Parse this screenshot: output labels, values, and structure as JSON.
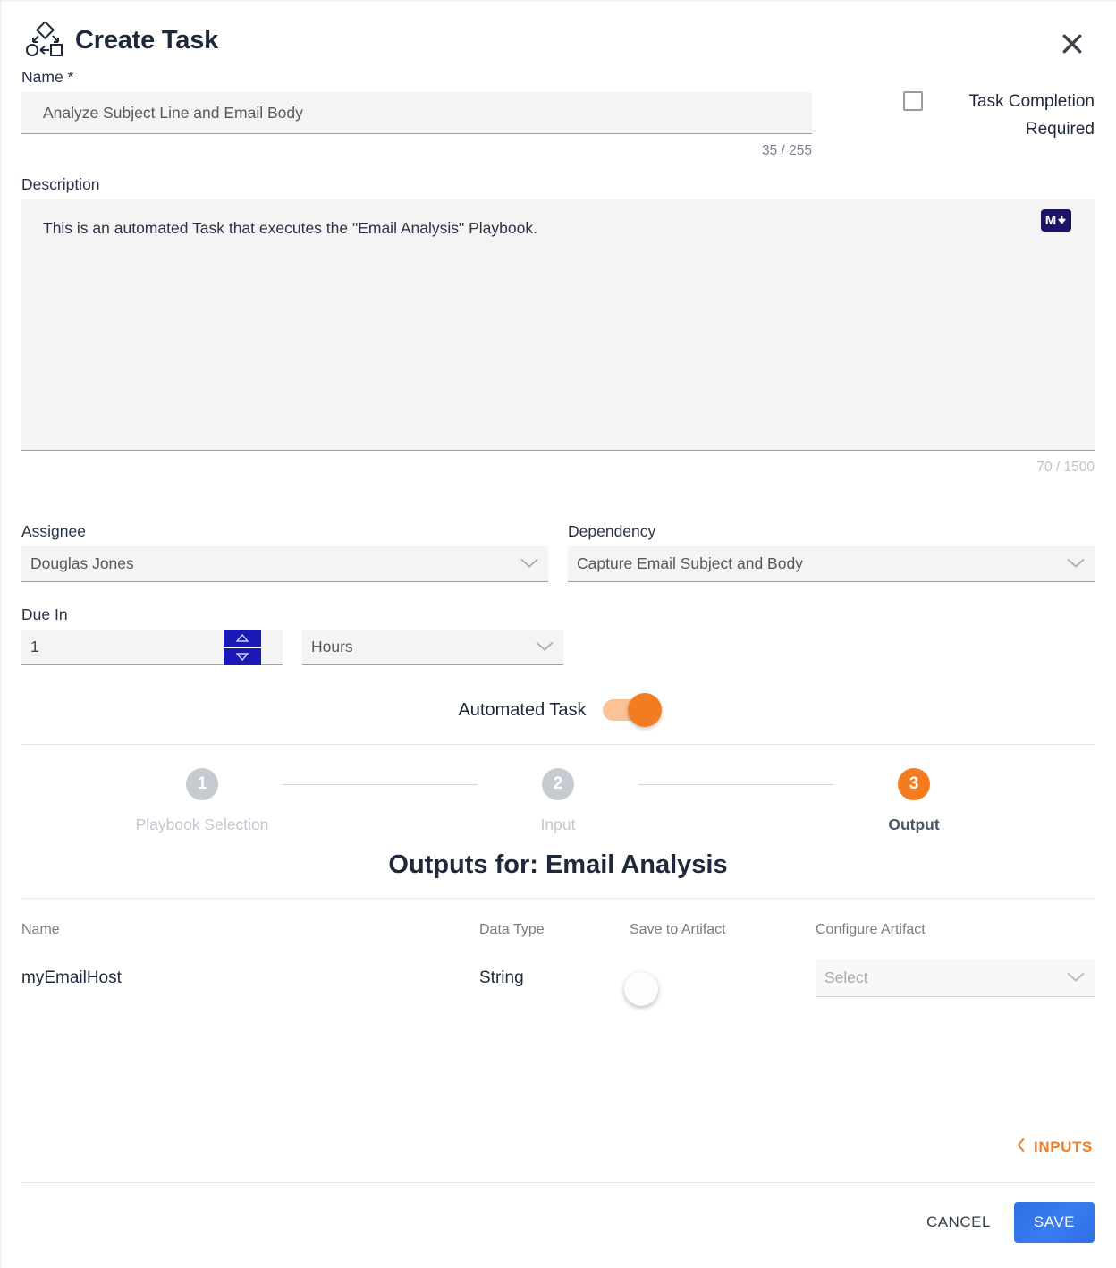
{
  "header": {
    "title": "Create Task",
    "icon": "workflow-icon",
    "close_icon": "close-icon"
  },
  "name_field": {
    "label": "Name *",
    "value": "Analyze Subject Line and Email Body",
    "placeholder": "Name",
    "counter": "35 / 255"
  },
  "task_completion": {
    "label": "Task Completion Required",
    "checked": false
  },
  "description_field": {
    "label": "Description",
    "value": "This is an automated Task that executes the \"Email Analysis\" Playbook.",
    "counter": "70 / 1500",
    "markdown_badge": "M"
  },
  "assignee": {
    "label": "Assignee",
    "value": "Douglas Jones"
  },
  "dependency": {
    "label": "Dependency",
    "value": "Capture Email Subject and Body"
  },
  "due_in": {
    "label": "Due In",
    "value": "1",
    "unit": "Hours"
  },
  "automated_task": {
    "label": "Automated Task",
    "enabled": true
  },
  "stepper": {
    "steps": [
      {
        "number": "1",
        "label": "Playbook Selection",
        "active": false
      },
      {
        "number": "2",
        "label": "Input",
        "active": false
      },
      {
        "number": "3",
        "label": "Output",
        "active": true
      }
    ]
  },
  "outputs": {
    "title": "Outputs for: Email Analysis",
    "columns": [
      "Name",
      "Data Type",
      "Save to Artifact",
      "Configure Artifact"
    ],
    "rows": [
      {
        "name": "myEmailHost",
        "data_type": "String",
        "save_to_artifact": false,
        "configure_artifact": "Select"
      }
    ]
  },
  "nav": {
    "inputs_label": "INPUTS",
    "back_icon": "chevron-left-icon"
  },
  "footer": {
    "cancel_label": "CANCEL",
    "save_label": "SAVE"
  },
  "colors": {
    "accent_orange": "#f47c20",
    "save_blue": "#3a7bf0",
    "spinner_navy": "#1a18b7",
    "markdown_navy": "#1b1464",
    "text_dark": "#20293c"
  }
}
